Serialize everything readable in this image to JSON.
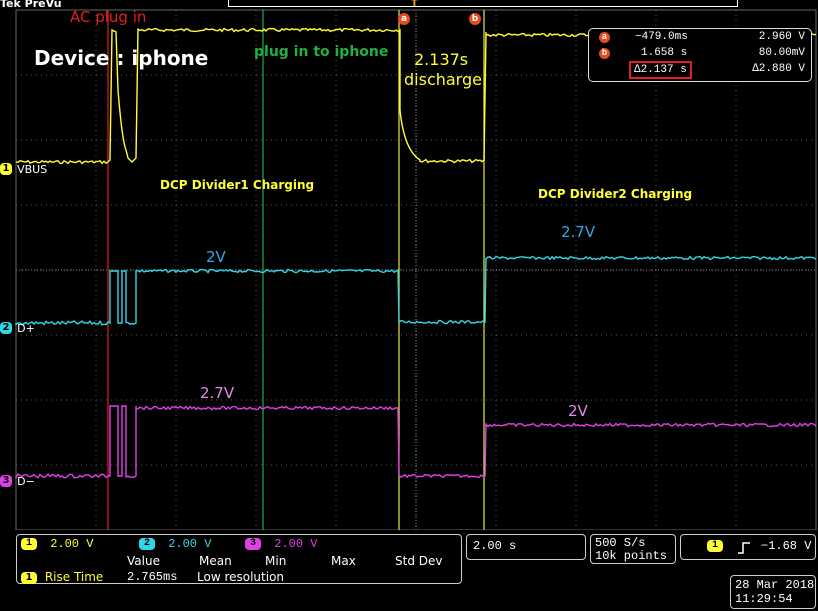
{
  "header": {
    "brand": "Tek PreVu",
    "trigger_marker": "T"
  },
  "annotations": {
    "ac_plug_in": "AC plug in",
    "device": "Device : iphone",
    "plug_in_to_iphone": "plug in to iphone",
    "discharge_time": "2.137s",
    "discharge": "discharge",
    "dcp_divider1": "DCP Divider1 Charging",
    "dcp_divider2": "DCP Divider2 Charging",
    "dplus_level_1": "2V",
    "dplus_level_2": "2.7V",
    "dminus_level_1": "2.7V",
    "dminus_level_2": "2V"
  },
  "cursors": {
    "a_label": "a",
    "b_label": "b"
  },
  "readout": {
    "a_time": "−479.0ms",
    "a_volt": "2.960 V",
    "b_time": "1.658 s",
    "b_volt": "80.00mV",
    "delta_time": "∆2.137 s",
    "delta_volt": "∆2.880 V"
  },
  "channels": [
    {
      "num": "1",
      "name": "VBUS",
      "scale": "2.00 V",
      "color": "#ffff33"
    },
    {
      "num": "2",
      "name": "D+",
      "scale": "2.00 V",
      "color": "#33d6e8"
    },
    {
      "num": "3",
      "name": "D−",
      "scale": "2.00 V",
      "color": "#e040e8"
    }
  ],
  "measurement": {
    "headers": [
      "Value",
      "Mean",
      "Min",
      "Max",
      "Std Dev"
    ],
    "channel": "1",
    "name": "Rise Time",
    "value": "2.765ms",
    "note": "Low resolution"
  },
  "timebase": {
    "per_div": "2.00 s"
  },
  "acquisition": {
    "rate": "500 S/s",
    "points": "10k points"
  },
  "trigger": {
    "channel": "1",
    "slope_icon": "rising-edge",
    "level": "−1.68 V"
  },
  "datetime": {
    "date": "28 Mar  2018",
    "time": "11:29:54"
  },
  "colors": {
    "ch1": "#ffff33",
    "ch2": "#33d6e8",
    "ch3": "#e040e8",
    "grid": "#5a5a5a",
    "ac_marker": "#e02020",
    "plug_marker": "#20b040",
    "cursor": "#e8e840",
    "cursor_badge": "#e84a1c"
  }
}
